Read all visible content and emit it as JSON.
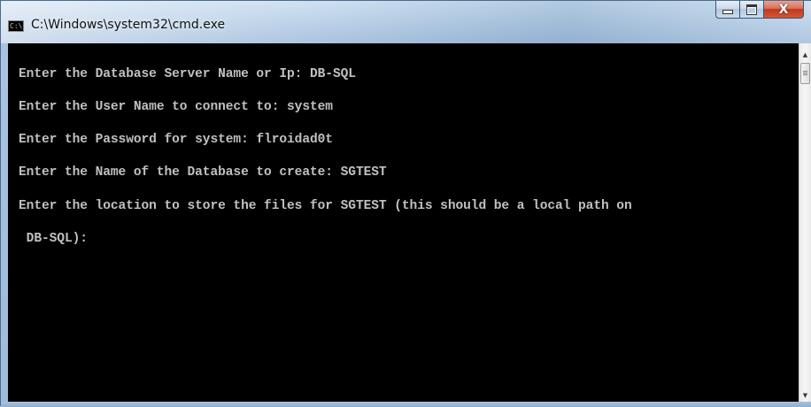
{
  "window": {
    "title": "C:\\Windows\\system32\\cmd.exe",
    "icon_label": "C:\\."
  },
  "caption_buttons": {
    "close_glyph": "X"
  },
  "console": {
    "background": "#000000",
    "text_color": "#c0c0c0",
    "lines": [
      "Enter the Database Server Name or Ip: DB-SQL",
      "Enter the User Name to connect to: system",
      "Enter the Password for system: flroidad0t",
      "Enter the Name of the Database to create: SGTEST",
      "Enter the location to store the files for SGTEST (this should be a local path on",
      " DB-SQL):"
    ]
  },
  "scrollbar": {
    "up_arrow": "▲",
    "down_arrow": "▼"
  }
}
